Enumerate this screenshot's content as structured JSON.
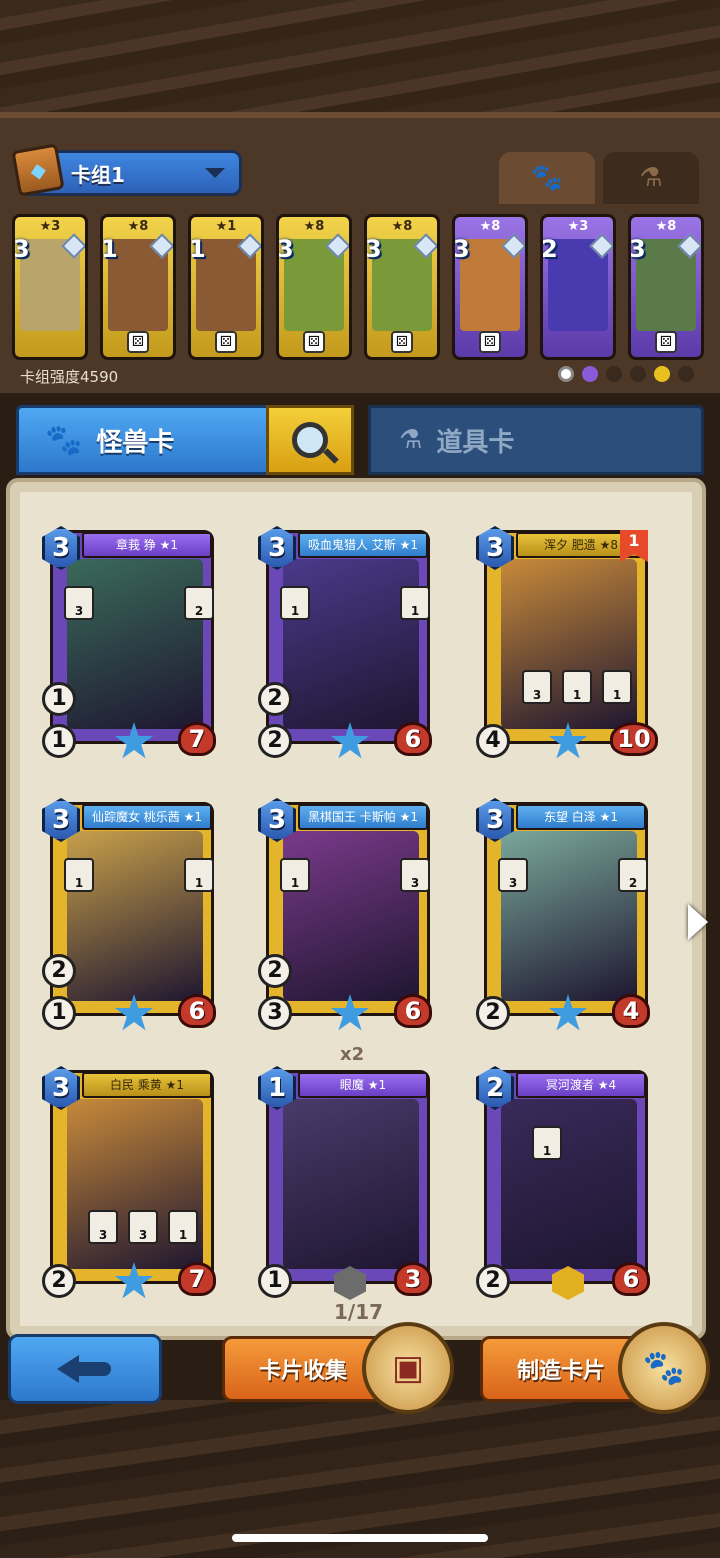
{
  "deck": {
    "name": "卡组1",
    "strength": "卡组强度4590",
    "cards": [
      {
        "cost": "3",
        "stars": "★3",
        "frame": "gold",
        "art": "#b9a46a",
        "dice": false
      },
      {
        "cost": "1",
        "stars": "★8",
        "frame": "gold",
        "art": "#8a5a34",
        "dice": true
      },
      {
        "cost": "1",
        "stars": "★1",
        "frame": "gold",
        "art": "#8a5a34",
        "dice": true
      },
      {
        "cost": "3",
        "stars": "★8",
        "frame": "gold",
        "art": "#7a9a3a",
        "dice": true
      },
      {
        "cost": "3",
        "stars": "★8",
        "frame": "gold",
        "art": "#7a9a3a",
        "dice": true
      },
      {
        "cost": "3",
        "stars": "★8",
        "frame": "purple",
        "art": "#c07a3a",
        "dice": true
      },
      {
        "cost": "2",
        "stars": "★3",
        "frame": "purple",
        "art": "#4a3ab0",
        "dice": false
      },
      {
        "cost": "3",
        "stars": "★8",
        "frame": "purple",
        "art": "#5a7a4a",
        "dice": true
      }
    ]
  },
  "tabs": {
    "monster": "怪兽卡",
    "item": "道具卡"
  },
  "cards": [
    {
      "name": "章莪 狰 ★1",
      "cost": "3",
      "frame": "purple",
      "banner": "green",
      "art": "#3a6a5a",
      "stat_top": "1",
      "stat_bottom": "1",
      "hp": "7",
      "abilities": [
        "3",
        "2"
      ]
    },
    {
      "name": "吸血鬼猎人 艾斯 ★1",
      "cost": "3",
      "frame": "purple",
      "banner": "blue",
      "art": "#4a3a8a",
      "stat_top": "2",
      "stat_bottom": "2",
      "hp": "6",
      "abilities": [
        "1",
        "1"
      ]
    },
    {
      "name": "浑夕 肥遗 ★8",
      "cost": "3",
      "frame": "gold",
      "banner": "yellow",
      "art": "#c88a3a",
      "stat_top": "",
      "stat_bottom": "4",
      "hp": "10",
      "abilities": [
        "3",
        "1",
        "1"
      ],
      "rank": "1"
    },
    {
      "name": "仙踪魔女 桃乐茜 ★1",
      "cost": "3",
      "frame": "gold",
      "banner": "blue",
      "art": "#c8a04a",
      "stat_top": "2",
      "stat_bottom": "1",
      "hp": "6",
      "abilities": [
        "1",
        "1"
      ]
    },
    {
      "name": "黑棋国王 卡斯帕 ★1",
      "cost": "3",
      "frame": "gold",
      "banner": "blue",
      "art": "#7a3a8a",
      "stat_top": "2",
      "stat_bottom": "3",
      "hp": "6",
      "abilities": [
        "1",
        "3"
      ]
    },
    {
      "name": "东望 白泽 ★1",
      "cost": "3",
      "frame": "gold",
      "banner": "blue",
      "art": "#7aa89a",
      "stat_top": "",
      "stat_bottom": "2",
      "hp": "4",
      "abilities": [
        "3",
        "2"
      ]
    },
    {
      "name": "白民 乘黄 ★1",
      "cost": "3",
      "frame": "gold",
      "banner": "yellow",
      "art": "#c88a3a",
      "stat_top": "",
      "stat_bottom": "2",
      "hp": "7",
      "abilities": [
        "3",
        "3",
        "1"
      ]
    },
    {
      "name": "眼魔 ★1",
      "cost": "1",
      "frame": "purple",
      "banner": "purple",
      "art": "#4a3a6a",
      "stat_top": "",
      "stat_bottom": "1",
      "hp": "3",
      "abilities": []
    },
    {
      "name": "冥河渡者 ★4",
      "cost": "2",
      "frame": "purple",
      "banner": "purple",
      "art": "#3a2a5a",
      "stat_top": "",
      "stat_bottom": "2",
      "hp": "6",
      "abilities": [
        "1"
      ]
    }
  ],
  "duplicate_label": "x2",
  "page": "1/17",
  "buttons": {
    "collect": "卡片收集",
    "craft": "制造卡片"
  }
}
